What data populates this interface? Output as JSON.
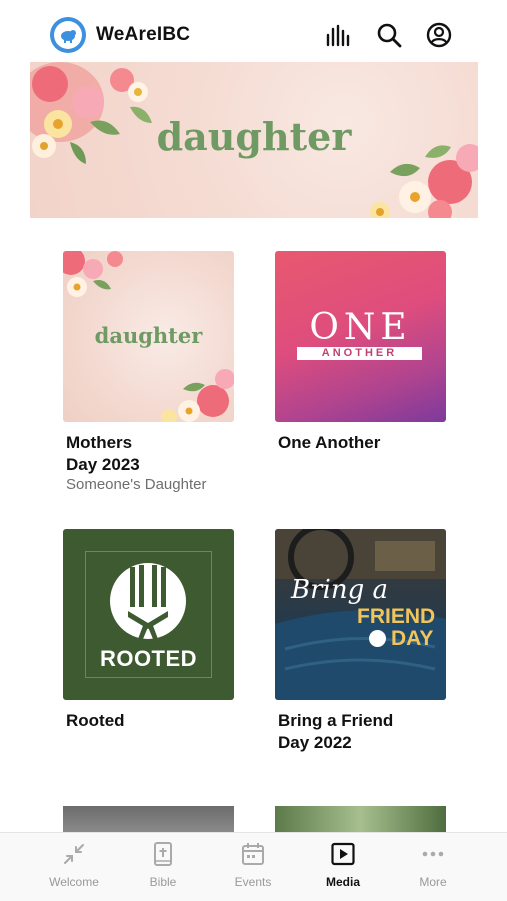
{
  "header": {
    "app_name": "WeAreIBC",
    "icons": [
      "logo-sheep-icon",
      "audio-bars-icon",
      "search-icon",
      "account-icon"
    ]
  },
  "banner": {
    "title": "daughter"
  },
  "grid": {
    "items": [
      {
        "art_text": "daughter",
        "title": "Mothers\nDay 2023",
        "subtitle": "Someone's Daughter"
      },
      {
        "art_line1": "ONE",
        "art_line2": "ANOTHER",
        "title": "One Another"
      },
      {
        "art_text": "ROOTED",
        "title": "Rooted"
      },
      {
        "art_line1": "Bring a",
        "art_line2": "FRIEND",
        "art_line3": "DAY",
        "title": "Bring a Friend\nDay 2022"
      }
    ]
  },
  "tabs": [
    {
      "label": "Welcome",
      "icon": "collapse-arrows-icon"
    },
    {
      "label": "Bible",
      "icon": "bible-icon"
    },
    {
      "label": "Events",
      "icon": "calendar-icon"
    },
    {
      "label": "Media",
      "icon": "play-square-icon",
      "active": true
    },
    {
      "label": "More",
      "icon": "more-dots-icon"
    }
  ],
  "colors": {
    "accent_blue": "#3d8fe0",
    "banner_text_green": "#6f9a63",
    "rooted_green": "#3e5a31",
    "one_magenta": "#de4d7d"
  }
}
